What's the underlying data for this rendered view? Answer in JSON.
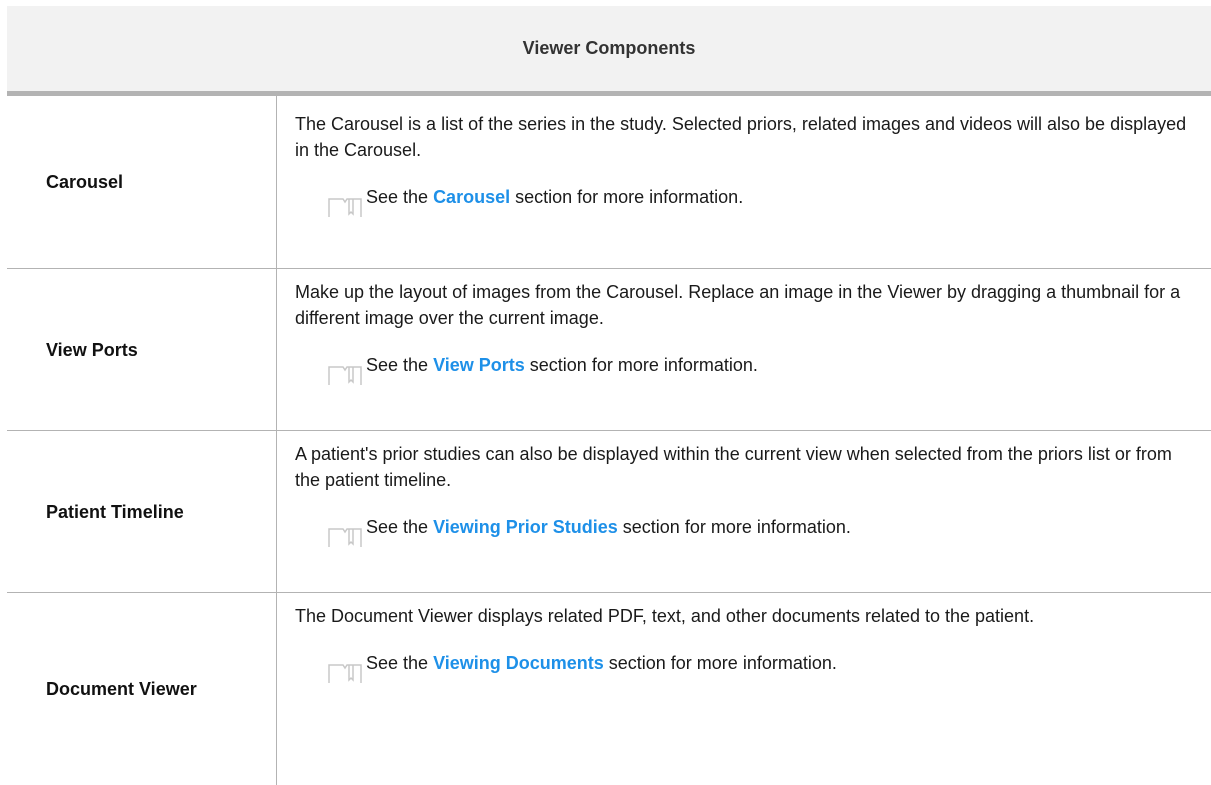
{
  "table": {
    "header": "Viewer Components",
    "rows": [
      {
        "name": "Carousel",
        "description": "The Carousel is a list of the series in the study. Selected priors, related images and videos will also be displayed in the Carousel.",
        "note_prefix": "See the ",
        "note_link": "Carousel",
        "note_suffix": " section for more information."
      },
      {
        "name": "View Ports",
        "description": "Make up the layout of images from the Carousel. Replace an image in the Viewer by dragging a thumbnail for a different image over the current image.",
        "note_prefix": "See the ",
        "note_link": "View Ports",
        "note_suffix": " section for more information."
      },
      {
        "name": "Patient Timeline",
        "description": "A patient's prior studies can also be displayed within the current view when selected from the priors list or from the patient timeline.",
        "note_prefix": "See the ",
        "note_link": "Viewing Prior Studies",
        "note_suffix": " section for more information."
      },
      {
        "name": "Document Viewer",
        "description": "The Document Viewer displays related PDF, text, and other documents related to the patient.",
        "note_prefix": "See the ",
        "note_link": "Viewing Documents",
        "note_suffix": " section for more information."
      }
    ]
  },
  "colors": {
    "link": "#1e90e8",
    "header_bg": "#f2f2f2",
    "border": "#b3b3b3"
  },
  "icons": {
    "note": "book-note-icon"
  }
}
